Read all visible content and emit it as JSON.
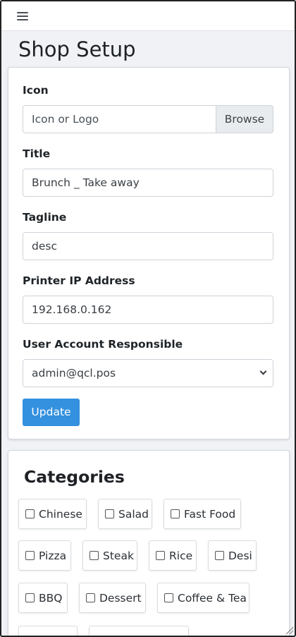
{
  "topbar": {
    "menu_icon": "hamburger-icon"
  },
  "page": {
    "title": "Shop Setup"
  },
  "setup": {
    "icon": {
      "label": "Icon",
      "placeholder": "Icon or Logo",
      "browse_label": "Browse"
    },
    "title": {
      "label": "Title",
      "value": "Brunch _ Take away"
    },
    "tagline": {
      "label": "Tagline",
      "value": "desc"
    },
    "printer": {
      "label": "Printer IP Address",
      "value": "192.168.0.162"
    },
    "user": {
      "label": "User Account Responsible",
      "value": "admin@qcl.pos"
    },
    "update_label": "Update"
  },
  "categories": {
    "title": "Categories",
    "items": [
      {
        "label": "Chinese"
      },
      {
        "label": "Salad"
      },
      {
        "label": "Fast Food"
      },
      {
        "label": "Pizza"
      },
      {
        "label": "Steak"
      },
      {
        "label": "Rice"
      },
      {
        "label": "Desi"
      },
      {
        "label": "BBQ"
      },
      {
        "label": "Dessert"
      },
      {
        "label": "Coffee & Tea"
      }
    ]
  },
  "colors": {
    "primary": "#3391df",
    "background": "#f0f2f5"
  }
}
